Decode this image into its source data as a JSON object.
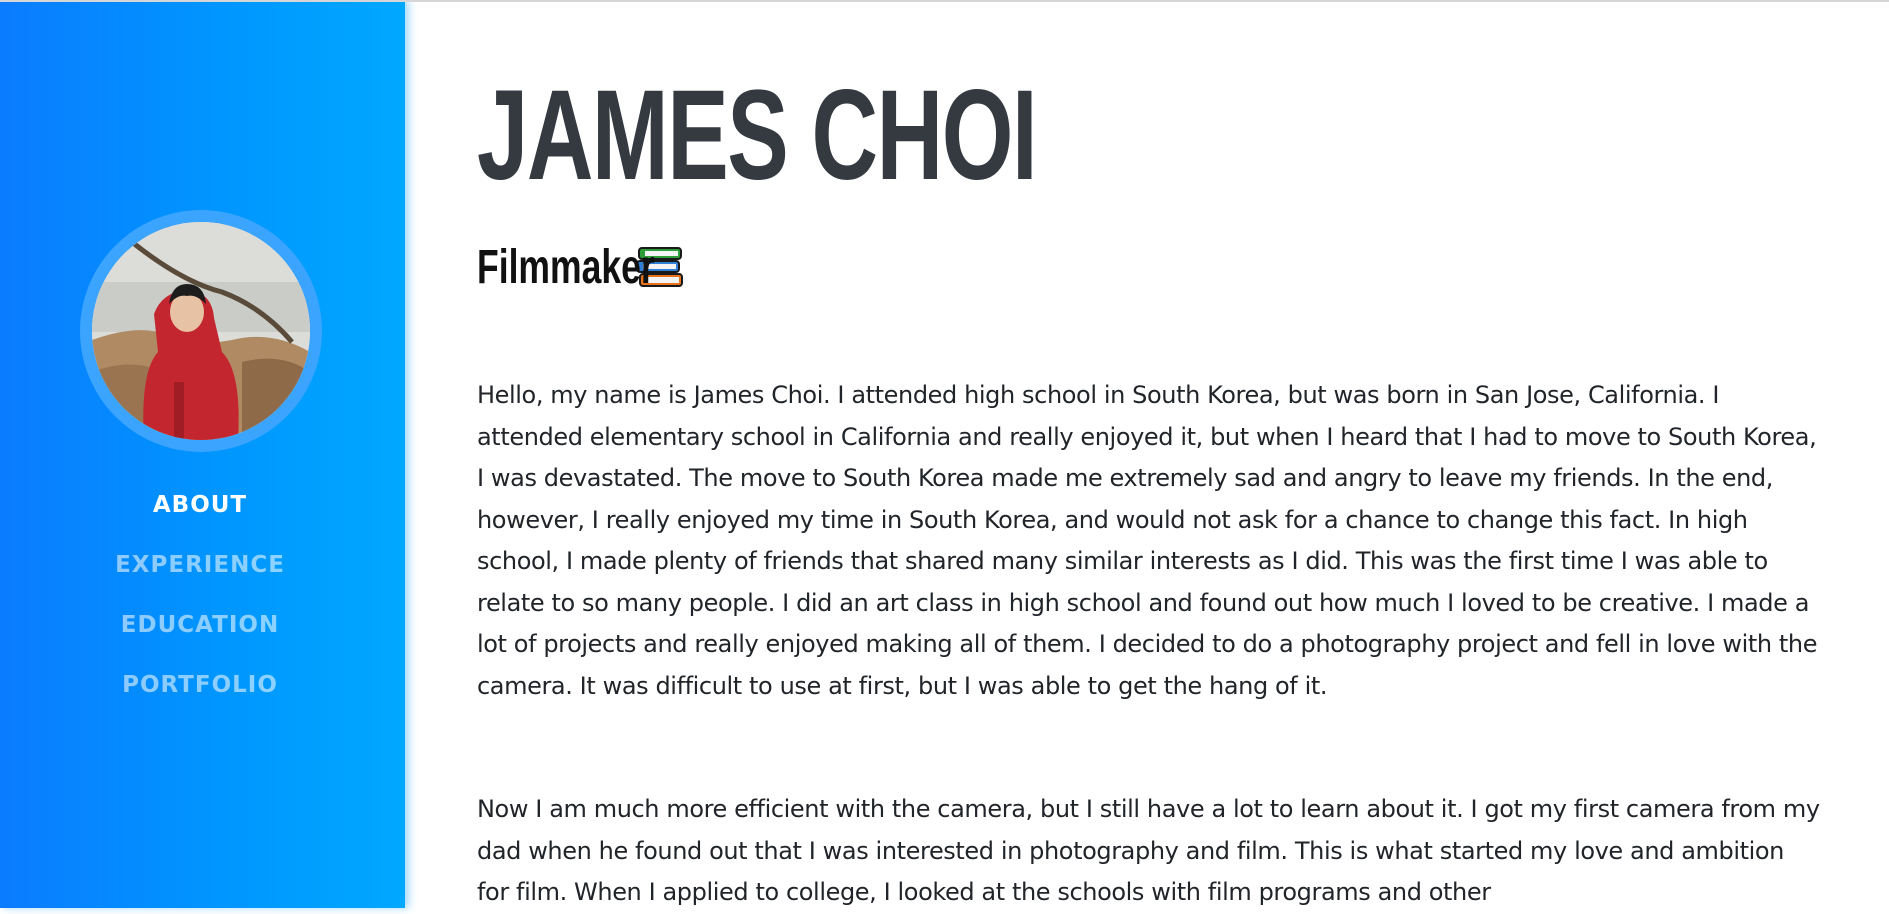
{
  "sidebar": {
    "avatar_alt": "Profile photo of James Choi",
    "nav_items": [
      {
        "label": "ABOUT",
        "active": true
      },
      {
        "label": "EXPERIENCE",
        "active": false
      },
      {
        "label": "EDUCATION",
        "active": false
      },
      {
        "label": "PORTFOLIO",
        "active": false
      }
    ]
  },
  "header": {
    "name": "JAMES CHOI",
    "subtitle": "Filmmaker",
    "subtitle_icon": "books-icon"
  },
  "about": {
    "paragraphs": [
      "Hello, my name is James Choi. I attended high school in South Korea, but was born in San Jose, California. I attended elementary school in California and really enjoyed it, but when I heard that I had to move to South Korea, I was devastated. The move to South Korea made me extremely sad and angry to leave my friends. In the end, however, I really enjoyed my time in South Korea, and would not ask for a chance to change this fact. In high school, I made plenty of friends that shared many similar interests as I did. This was the first time I was able to relate to so many people. I did an art class in high school and found out how much I loved to be creative. I made a lot of projects and really enjoyed making all of them. I decided to do a photography project and fell in love with the camera. It was difficult to use at first, but I was able to get the hang of it.",
      "Now I am much more efficient with the camera, but I still have a lot to learn about it. I got my first camera from my dad when he found out that I was interested in photography and film. This is what started my love and ambition for film. When I applied to college, I looked at the schools with film programs and other"
    ]
  },
  "colors": {
    "sidebar_gradient_start": "#0a7cff",
    "sidebar_gradient_end": "#00a8ff",
    "heading": "#343a40",
    "body_text": "#212529"
  }
}
